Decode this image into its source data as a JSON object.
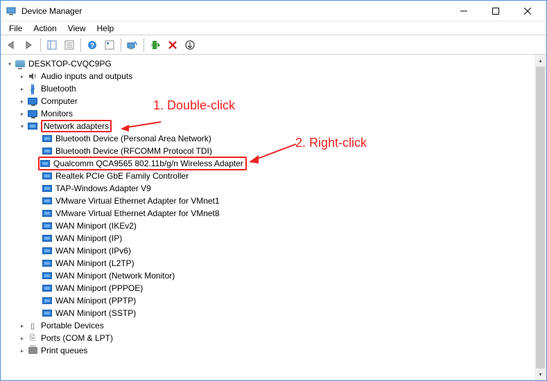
{
  "title": "Device Manager",
  "menu": {
    "file": "File",
    "action": "Action",
    "view": "View",
    "help": "Help"
  },
  "annotations": {
    "a1": "1. Double-click",
    "a2": "2. Right-click"
  },
  "tree": {
    "root": "DESKTOP-CVQC9PG",
    "audio": "Audio inputs and outputs",
    "bluetooth": "Bluetooth",
    "computer": "Computer",
    "monitors": "Monitors",
    "netadapters": "Network adapters",
    "net": {
      "n0": "Bluetooth Device (Personal Area Network)",
      "n1": "Bluetooth Device (RFCOMM Protocol TDI)",
      "n2": "Qualcomm QCA9565 802.11b/g/n Wireless Adapter",
      "n3": "Realtek PCIe GbE Family Controller",
      "n4": "TAP-Windows Adapter V9",
      "n5": "VMware Virtual Ethernet Adapter for VMnet1",
      "n6": "VMware Virtual Ethernet Adapter for VMnet8",
      "n7": "WAN Miniport (IKEv2)",
      "n8": "WAN Miniport (IP)",
      "n9": "WAN Miniport (IPv6)",
      "n10": "WAN Miniport (L2TP)",
      "n11": "WAN Miniport (Network Monitor)",
      "n12": "WAN Miniport (PPPOE)",
      "n13": "WAN Miniport (PPTP)",
      "n14": "WAN Miniport (SSTP)"
    },
    "portable": "Portable Devices",
    "ports": "Ports (COM & LPT)",
    "printq": "Print queues"
  }
}
